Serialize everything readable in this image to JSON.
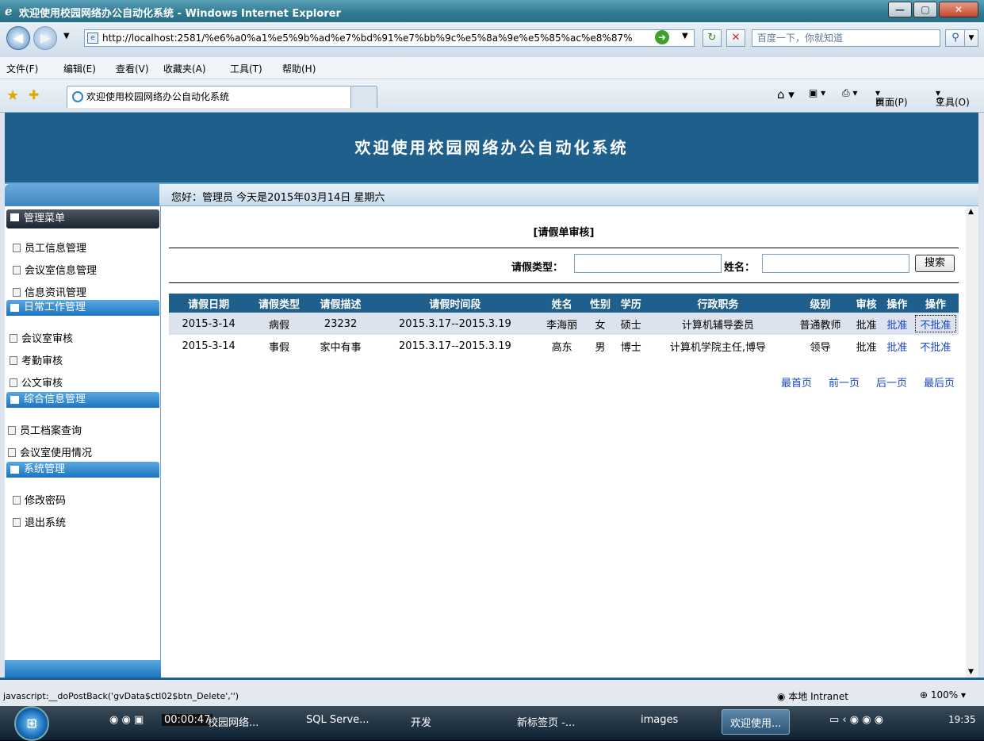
{
  "window": {
    "title": "欢迎使用校园网络办公自动化系统 - Windows Internet Explorer",
    "min_label": "—",
    "max_label": "▢",
    "close_label": "✕"
  },
  "address": {
    "url": "http://localhost:2581/%e6%a0%a1%e5%9b%ad%e7%bd%91%e7%bb%9c%e5%8a%9e%e5%85%ac%e8%87%",
    "search_placeholder": "百度一下，你就知道"
  },
  "menubar": [
    "文件(F)",
    "编辑(E)",
    "查看(V)",
    "收藏夹(A)",
    "工具(T)",
    "帮助(H)"
  ],
  "tabbar": {
    "tab_title": "欢迎使用校园网络办公自动化系统",
    "cmd_page": "页面(P)",
    "cmd_tools": "工具(O)"
  },
  "page": {
    "banner_title": "欢迎使用校园网络办公自动化系统",
    "greeting": "您好：管理员   今天是2015年03月14日   星期六"
  },
  "sidebar": {
    "menu_title": "管理菜单",
    "group1": [
      "员工信息管理",
      "会议室信息管理",
      "信息资讯管理"
    ],
    "sec2": "日常工作管理",
    "group2": [
      "会议室审核",
      "考勤审核",
      "公文审核"
    ],
    "sec3": "综合信息管理",
    "group3": [
      "员工档案查询",
      "会议室使用情况"
    ],
    "sec4": "系统管理",
    "group4": [
      "修改密码",
      "退出系统"
    ]
  },
  "main": {
    "panel_title": "[请假单审核]",
    "type_label": "请假类型：",
    "name_label": "姓名：",
    "search_btn": "搜索",
    "columns": [
      "请假日期",
      "请假类型",
      "请假描述",
      "请假时间段",
      "姓名",
      "性别",
      "学历",
      "行政职务",
      "级别",
      "审核",
      "操作",
      "操作"
    ],
    "rows": [
      [
        "2015-3-14",
        "病假",
        "23232",
        "2015.3.17--2015.3.19",
        "李海丽",
        "女",
        "硕士",
        "计算机辅导委员",
        "普通教师",
        "批准",
        "批准",
        "不批准"
      ],
      [
        "2015-3-14",
        "事假",
        "家中有事",
        "2015.3.17--2015.3.19",
        "高东",
        "男",
        "博士",
        "计算机学院主任,博导",
        "领导",
        "批准",
        "批准",
        "不批准"
      ]
    ],
    "pager": [
      "最首页",
      "前一页",
      "后一页",
      "最后页"
    ]
  },
  "status": {
    "text": "javascript:__doPostBack('gvData$ctl02$btn_Delete','')",
    "zone": "本地 Intranet",
    "zoom": "100%"
  },
  "taskbar": {
    "timer": "00:00:47",
    "items": [
      "校园网络...",
      "SQL Serve...",
      "开发",
      "新标签页 -...",
      "images",
      "欢迎使用..."
    ],
    "clock": "19:35"
  }
}
